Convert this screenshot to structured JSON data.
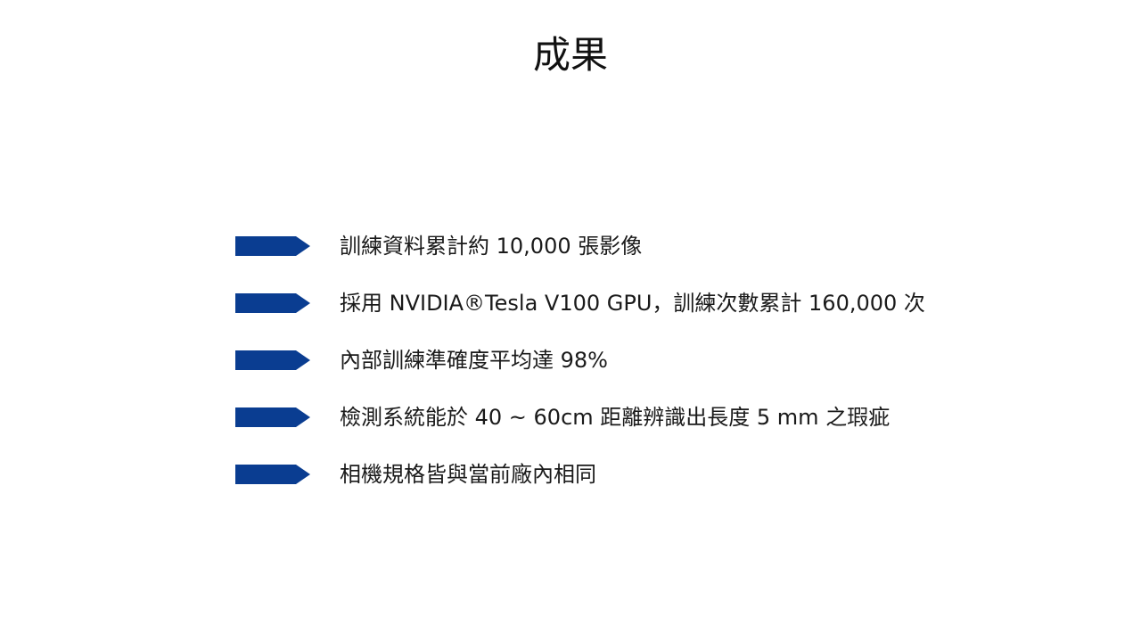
{
  "slide": {
    "title": "成果",
    "accent_color": "#0a3d91",
    "bullet_icon": "arrow-tag-icon",
    "items": [
      {
        "text": "訓練資料累計約 10,000 張影像"
      },
      {
        "text": "採用 NVIDIA®Tesla V100 GPU，訓練次數累計 160,000 次"
      },
      {
        "text": "內部訓練準確度平均達 98%"
      },
      {
        "text": "檢測系統能於 40 ~ 60cm 距離辨識出長度 5 mm 之瑕疵"
      },
      {
        "text": "相機規格皆與當前廠內相同"
      }
    ]
  }
}
